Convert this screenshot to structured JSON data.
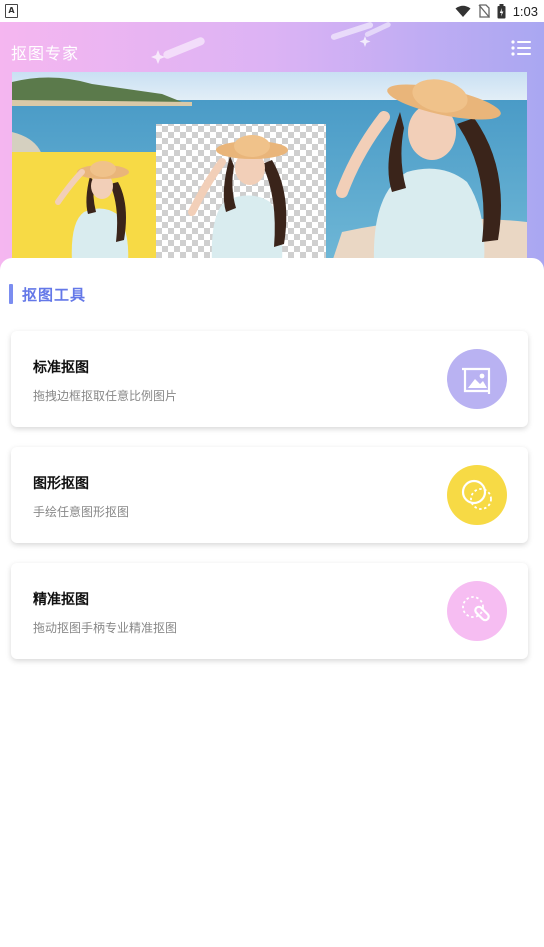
{
  "status_bar": {
    "time": "1:03",
    "app_indicator": "A"
  },
  "header": {
    "title": "抠图专家",
    "menu_icon": "menu-icon"
  },
  "section": {
    "title": "抠图工具"
  },
  "tools": [
    {
      "title": "标准抠图",
      "subtitle": "拖拽边框抠取任意比例图片",
      "icon": "image-crop-icon",
      "color": "#b9b2f2"
    },
    {
      "title": "图形抠图",
      "subtitle": "手绘任意图形抠图",
      "icon": "lasso-circle-icon",
      "color": "#f7da45"
    },
    {
      "title": "精准抠图",
      "subtitle": "拖动抠图手柄专业精准抠图",
      "icon": "precision-handle-icon",
      "color": "#f6bdf2"
    }
  ],
  "colors": {
    "header_gradient_start": "#f5b6f0",
    "header_gradient_end": "#a9a7f2",
    "accent": "#6478e8"
  }
}
